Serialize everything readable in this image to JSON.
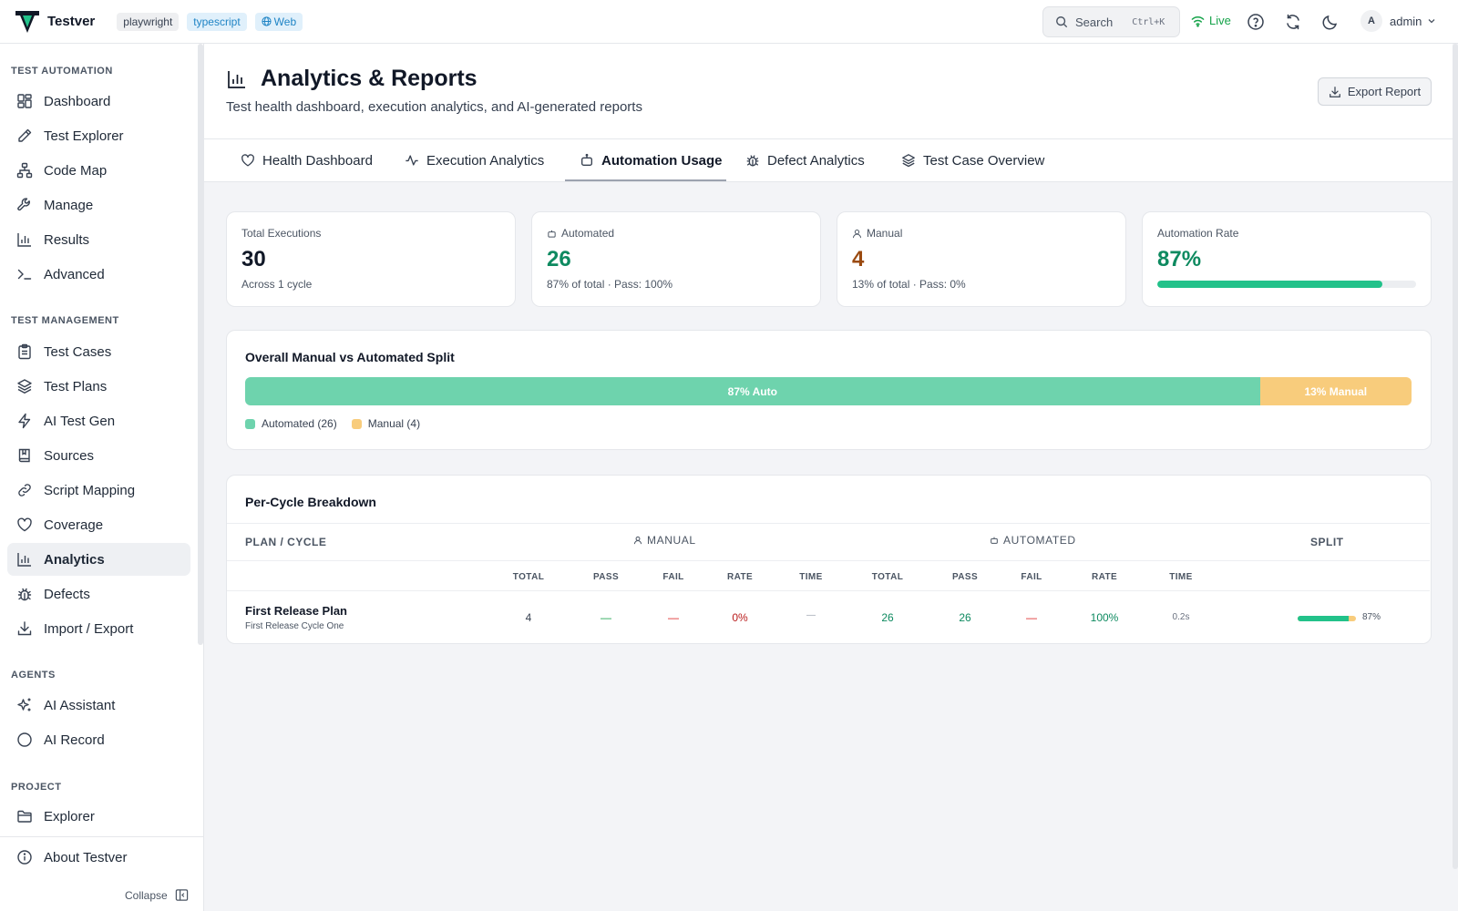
{
  "app": {
    "name": "Testver",
    "tags": [
      "playwright",
      "typescript",
      "Web"
    ]
  },
  "topbar": {
    "search_label": "Search",
    "search_shortcut": "Ctrl+K",
    "live_label": "Live",
    "user_initial": "A",
    "user_name": "admin",
    "icons": [
      "search-icon",
      "wifi-icon",
      "help-icon",
      "refresh-icon",
      "moon-icon",
      "chevron-down-icon"
    ]
  },
  "sidebar": {
    "sections": {
      "automation": "TEST AUTOMATION",
      "management": "TEST MANAGEMENT",
      "agents": "AGENTS",
      "project": "PROJECT"
    },
    "items": [
      {
        "label": "Dashboard",
        "icon": "dashboard-icon"
      },
      {
        "label": "Test Explorer",
        "icon": "pencil-icon"
      },
      {
        "label": "Code Map",
        "icon": "network-icon"
      },
      {
        "label": "Manage",
        "icon": "wrench-icon"
      },
      {
        "label": "Results",
        "icon": "bar-chart-icon"
      },
      {
        "label": "Advanced",
        "icon": "terminal-icon"
      },
      {
        "label": "Test Cases",
        "icon": "clipboard-icon"
      },
      {
        "label": "Test Plans",
        "icon": "layers-icon"
      },
      {
        "label": "AI Test Gen",
        "icon": "zap-icon"
      },
      {
        "label": "Sources",
        "icon": "book-icon"
      },
      {
        "label": "Script Mapping",
        "icon": "link-icon"
      },
      {
        "label": "Coverage",
        "icon": "heart-icon"
      },
      {
        "label": "Analytics",
        "icon": "bar-chart-icon"
      },
      {
        "label": "Defects",
        "icon": "bug-icon"
      },
      {
        "label": "Import / Export",
        "icon": "download-icon"
      },
      {
        "label": "AI Assistant",
        "icon": "sparkles-icon"
      },
      {
        "label": "AI Record",
        "icon": "circle-icon"
      },
      {
        "label": "Explorer",
        "icon": "folder-icon"
      }
    ],
    "active": "Analytics",
    "about": "About Testver",
    "collapse": "Collapse"
  },
  "page": {
    "title": "Analytics & Reports",
    "subtitle": "Test health dashboard, execution analytics, and AI-generated reports",
    "export_label": "Export Report"
  },
  "tabs": [
    {
      "label": "Health Dashboard",
      "icon": "heart-icon"
    },
    {
      "label": "Execution Analytics",
      "icon": "activity-icon"
    },
    {
      "label": "Automation Usage",
      "icon": "bot-icon"
    },
    {
      "label": "Defect Analytics",
      "icon": "bug-icon"
    },
    {
      "label": "Test Case Overview",
      "icon": "layers-icon"
    }
  ],
  "active_tab": "Automation Usage",
  "stats": [
    {
      "label": "Total Executions",
      "value": "30",
      "sub": "Across 1 cycle",
      "color": "#111827"
    },
    {
      "label": "Automated",
      "value": "26",
      "sub": "87% of total · Pass: 100%",
      "color": "#0e8a60"
    },
    {
      "label": "Manual",
      "value": "4",
      "sub": "13% of total · Pass: 0%",
      "color": "#9a4a10"
    },
    {
      "label": "Automation Rate",
      "value": "87%",
      "color": "#0e8a60",
      "progress": 0.87
    }
  ],
  "split": {
    "title": "Overall Manual vs Automated Split",
    "auto_fraction": 0.87,
    "auto_label": "87% Auto",
    "manual_label": "13% Manual",
    "legend_auto": "Automated (26)",
    "legend_manual": "Manual (4)",
    "colors": {
      "auto": "#6ed3ad",
      "manual": "#f8cc7c"
    }
  },
  "breakdown": {
    "title": "Per-Cycle Breakdown",
    "col_plan": "PLAN / CYCLE",
    "col_manual": "MANUAL",
    "col_automated": "AUTOMATED",
    "col_split": "SPLIT",
    "sub_headers": [
      "TOTAL",
      "PASS",
      "FAIL",
      "RATE",
      "TIME",
      "TOTAL",
      "PASS",
      "FAIL",
      "RATE",
      "TIME"
    ],
    "rows": [
      {
        "plan": "First Release Plan",
        "cycle": "First Release Cycle One",
        "manual": {
          "total": "4",
          "pass": "—",
          "fail": "—",
          "rate": "0%",
          "time": "—"
        },
        "automated": {
          "total": "26",
          "pass": "26",
          "fail": "—",
          "rate": "100%",
          "time": "0.2s"
        },
        "split_fraction": 0.87,
        "split_label": "87%"
      }
    ]
  }
}
